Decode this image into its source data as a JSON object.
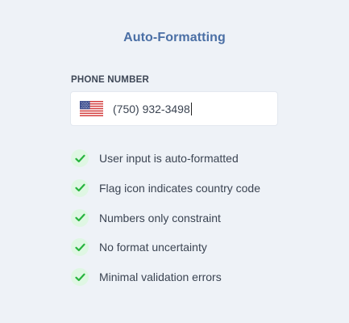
{
  "header": {
    "title": "Auto-Formatting"
  },
  "phone": {
    "label": "PHONE NUMBER",
    "value": "(750) 932-3498",
    "flag_icon": "us-flag-icon"
  },
  "features": [
    {
      "text": "User input is auto-formatted",
      "icon": "check-icon"
    },
    {
      "text": "Flag icon indicates country code",
      "icon": "check-icon"
    },
    {
      "text": "Numbers only constraint",
      "icon": "check-icon"
    },
    {
      "text": "No format uncertainty",
      "icon": "check-icon"
    },
    {
      "text": "Minimal validation errors",
      "icon": "check-icon"
    }
  ],
  "colors": {
    "background": "#eef2f7",
    "title": "#4a6fa5",
    "check": "#27b43e",
    "check_bg": "#dff7e3"
  }
}
